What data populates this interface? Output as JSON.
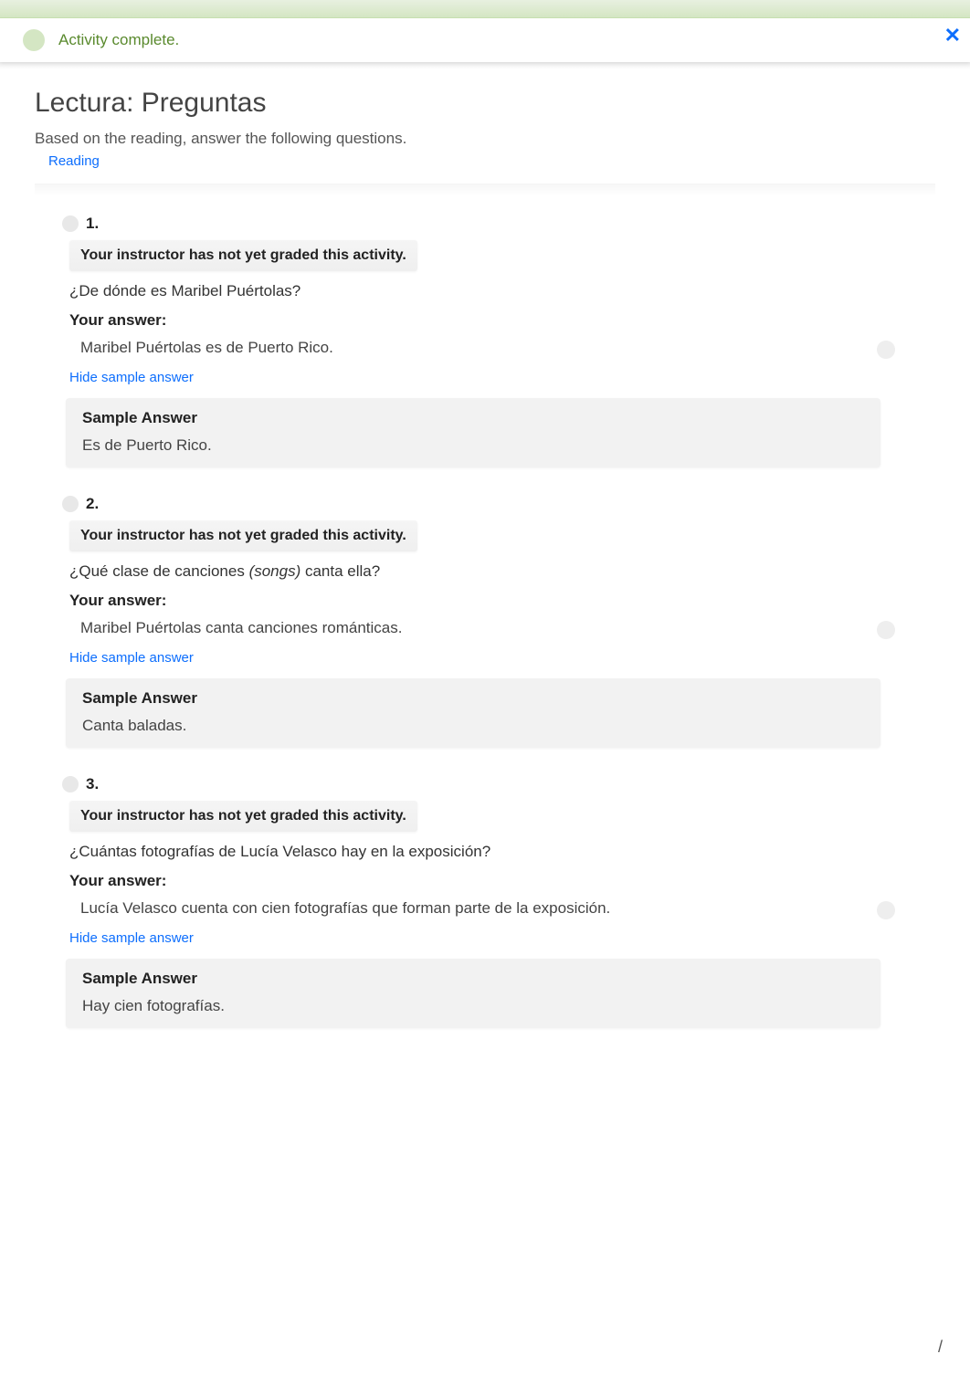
{
  "notification": {
    "text": "Activity complete.",
    "close_glyph": "✕"
  },
  "header": {
    "title": "Lectura: Preguntas",
    "subtitle": "Based on the reading, answer the following questions.",
    "reading_link": "Reading"
  },
  "common": {
    "grade_status": "Your instructor has not yet graded this activity.",
    "your_answer_label": "Your answer:",
    "hide_sample_label": "Hide sample answer",
    "sample_answer_label": "Sample Answer"
  },
  "questions": [
    {
      "number": "1.",
      "text_plain": "¿De dónde es Maribel Puértolas?",
      "your_answer": "Maribel Puértolas es de Puerto Rico.",
      "sample_answer": "Es de Puerto Rico."
    },
    {
      "number": "2.",
      "text_pre": "¿Qué clase de canciones ",
      "text_em": "(songs)",
      "text_post": " canta ella?",
      "your_answer": "Maribel Puértolas canta canciones románticas.",
      "sample_answer": "Canta baladas."
    },
    {
      "number": "3.",
      "text_plain": "¿Cuántas fotografías de Lucía Velasco hay en la exposición?",
      "your_answer": "Lucía Velasco cuenta con cien fotografías que forman parte de la exposición.",
      "sample_answer": "Hay cien fotografías."
    }
  ],
  "footer": {
    "slash": "/"
  }
}
